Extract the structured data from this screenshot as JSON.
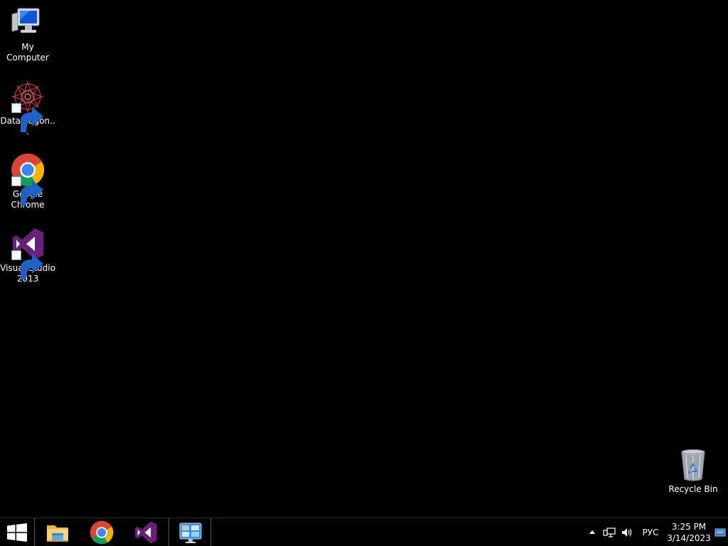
{
  "desktop": {
    "icons": [
      {
        "label": "My Computer",
        "icon": "my-computer-icon"
      },
      {
        "label": "DataWagon...",
        "icon": "datawagon-icon",
        "shortcut": true
      },
      {
        "label": "Google Chrome",
        "icon": "chrome-icon",
        "shortcut": true
      },
      {
        "label": "Visual Studio 2013",
        "icon": "visual-studio-icon",
        "shortcut": true
      }
    ],
    "recycle_bin": {
      "label": "Recycle Bin",
      "icon": "recycle-bin-icon"
    }
  },
  "taskbar": {
    "start": {
      "icon": "windows-start-icon"
    },
    "apps": [
      {
        "name": "File Explorer",
        "icon": "file-explorer-icon"
      },
      {
        "name": "Google Chrome",
        "icon": "chrome-icon"
      },
      {
        "name": "Visual Studio 2013",
        "icon": "visual-studio-icon"
      },
      {
        "name": "Control Panel",
        "icon": "control-panel-icon"
      }
    ],
    "tray": {
      "overflow_icon": "chevron-up-icon",
      "network_icon": "network-icon",
      "volume_icon": "speaker-icon",
      "language": "РУС",
      "time": "3:25 PM",
      "date": "3/14/2023",
      "show_desktop_icon": "action-center-icon"
    }
  },
  "colors": {
    "background": "#000000",
    "vs_purple": "#68217a",
    "text": "#ffffff"
  }
}
